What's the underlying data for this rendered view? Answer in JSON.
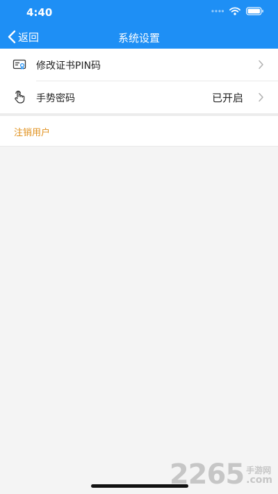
{
  "status_bar": {
    "time": "4:40",
    "icons": [
      "signal-dots-icon",
      "wifi-icon",
      "battery-icon"
    ]
  },
  "nav": {
    "back_label": "返回",
    "title": "系统设置"
  },
  "settings": {
    "items": [
      {
        "icon": "certificate-card-icon",
        "label": "修改证书PIN码",
        "value": ""
      },
      {
        "icon": "hand-gesture-icon",
        "label": "手势密码",
        "value": "已开启"
      }
    ],
    "logout_label": "注销用户"
  },
  "watermark": {
    "number": "2265",
    "text_cn": "手游网",
    "text_com": ".com"
  },
  "colors": {
    "header": "#1e8ff5",
    "background": "#f4f4f4",
    "logout_text": "#e0901c"
  }
}
